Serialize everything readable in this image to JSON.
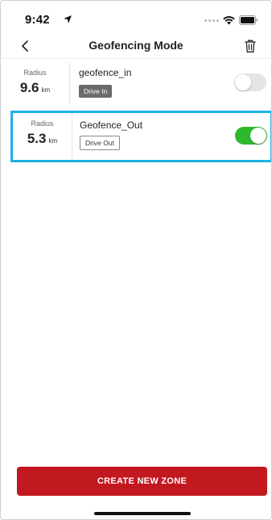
{
  "status_bar": {
    "time": "9:42",
    "location_icon": "location-arrow-icon",
    "wifi_icon": "wifi-icon",
    "battery_icon": "battery-icon"
  },
  "nav": {
    "title": "Geofencing Mode",
    "back_icon": "chevron-left-icon",
    "trash_icon": "trash-icon"
  },
  "zones": [
    {
      "radius_label": "Radius",
      "radius_value": "9.6",
      "radius_unit": "km",
      "name": "geofence_in",
      "tag": "Drive In",
      "enabled": false
    },
    {
      "radius_label": "Radius",
      "radius_value": "5.3",
      "radius_unit": "km",
      "name": "Geofence_Out",
      "tag": "Drive Out",
      "enabled": true
    }
  ],
  "create_button": {
    "label": "CREATE NEW ZONE"
  },
  "colors": {
    "brand_red": "#c2181f",
    "toggle_on": "#2eb82e",
    "toggle_off": "#e4e4e4",
    "selection_border": "#1fb1e6"
  }
}
